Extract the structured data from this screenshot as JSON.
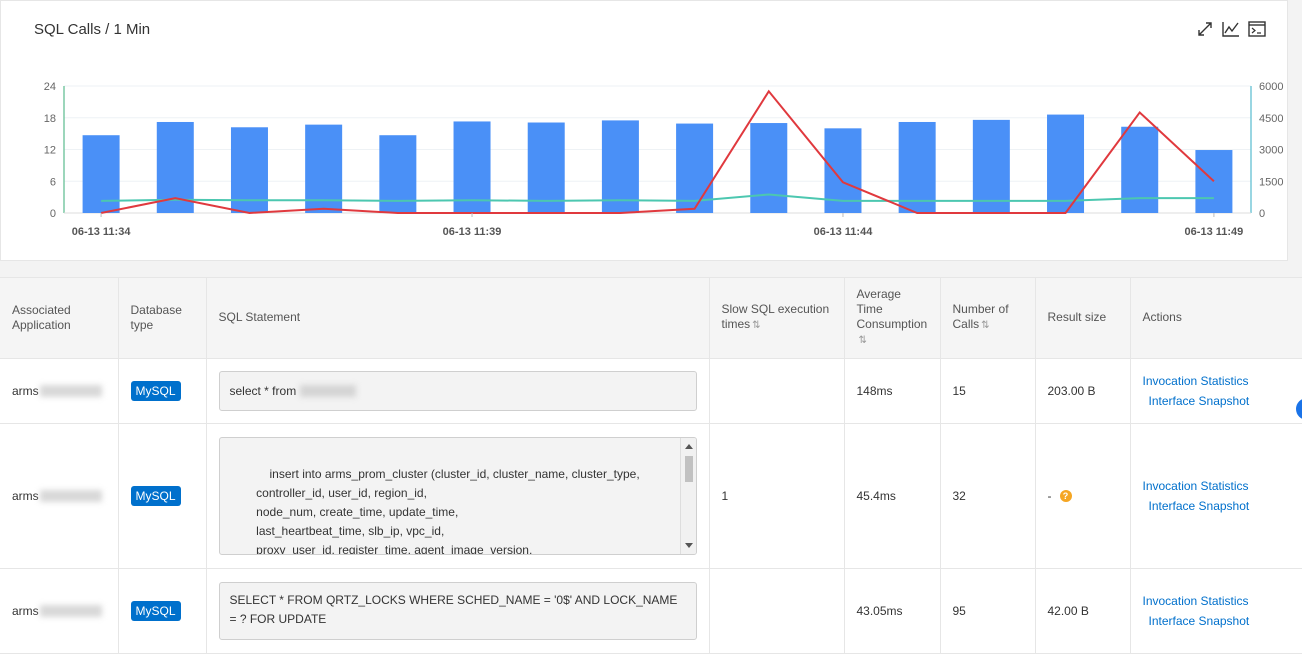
{
  "chart": {
    "title": "SQL Calls / 1 Min",
    "tools": [
      "expand-icon",
      "line-chart-icon",
      "console-icon"
    ]
  },
  "chart_data": {
    "type": "bar",
    "x_labels": [
      "06-13 11:34",
      "06-13 11:39",
      "06-13 11:44",
      "06-13 11:49"
    ],
    "left_ticks": [
      "24",
      "18",
      "12",
      "6",
      "0"
    ],
    "right_ticks": [
      "6000",
      "4500",
      "3000",
      "1500",
      "0"
    ],
    "ylim_left": [
      0,
      24
    ],
    "ylim_right": [
      0,
      6000
    ],
    "bars": [
      14.7,
      17.2,
      16.2,
      16.7,
      14.7,
      17.3,
      17.1,
      17.5,
      16.9,
      17.0,
      16.0,
      17.2,
      17.6,
      18.6,
      16.3,
      11.9
    ],
    "red_line": [
      0,
      700,
      0,
      200,
      0,
      0,
      0,
      0,
      200,
      5750,
      1450,
      0,
      0,
      0,
      4750,
      1500
    ],
    "green_line": [
      2.3,
      2.5,
      2.4,
      2.4,
      2.3,
      2.4,
      2.3,
      2.4,
      2.3,
      3.5,
      2.3,
      2.3,
      2.3,
      2.3,
      2.8,
      2.8
    ],
    "colors": {
      "bar": "#4a90f7",
      "red": "#e0393e",
      "green": "#4cc7b0",
      "axis_left": "#7bc8a4",
      "axis_right": "#77c8d8"
    }
  },
  "table": {
    "headers": {
      "app": "Associated Application",
      "db": "Database type",
      "sql": "SQL Statement",
      "slow": "Slow SQL execution times",
      "avg": "Average Time Consumption",
      "calls": "Number of Calls",
      "result": "Result size",
      "actions": "Actions"
    },
    "rows": [
      {
        "app": "arms",
        "db": "MySQL",
        "sql": "select * from",
        "slow": "",
        "avg": "148ms",
        "calls": "15",
        "result": "203.00 B",
        "action1": "Invocation Statistics",
        "action2": "Interface Snapshot"
      },
      {
        "app": "arms",
        "db": "MySQL",
        "sql": "insert into arms_prom_cluster (cluster_id, cluster_name, cluster_type,\n        controller_id, user_id, region_id,\n        node_num, create_time, update_time,\n        last_heartbeat_time, slb_ip, vpc_id,\n        proxy_user_id, register_time, agent_image_version,\n        agent_build_version, agent_deployment_name,",
        "slow": "1",
        "avg": "45.4ms",
        "calls": "32",
        "result": "-",
        "action1": "Invocation Statistics",
        "action2": "Interface Snapshot"
      },
      {
        "app": "arms",
        "db": "MySQL",
        "sql": "SELECT * FROM QRTZ_LOCKS WHERE SCHED_NAME = '0$' AND LOCK_NAME = ? FOR UPDATE",
        "slow": "",
        "avg": "43.05ms",
        "calls": "95",
        "result": "42.00 B",
        "action1": "Invocation Statistics",
        "action2": "Interface Snapshot"
      }
    ]
  }
}
